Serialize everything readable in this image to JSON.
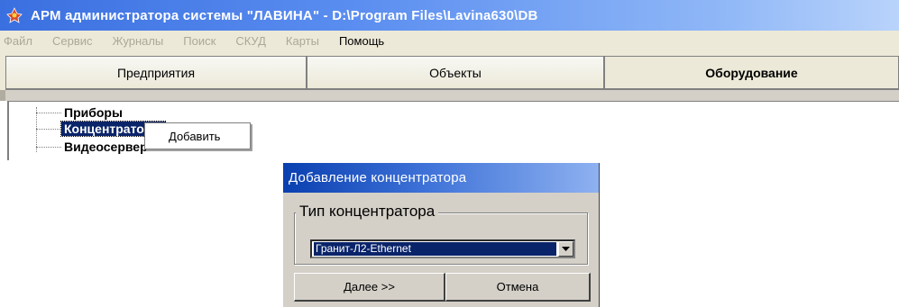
{
  "window": {
    "title": "АРМ администратора системы \"ЛАВИНА\" - D:\\Program Files\\Lavina630\\DB",
    "icon": "app-logo-icon"
  },
  "menu": {
    "items": [
      {
        "label": "Файл",
        "enabled": false
      },
      {
        "label": "Сервис",
        "enabled": false
      },
      {
        "label": "Журналы",
        "enabled": false
      },
      {
        "label": "Поиск",
        "enabled": false
      },
      {
        "label": "СКУД",
        "enabled": false
      },
      {
        "label": "Карты",
        "enabled": false
      },
      {
        "label": "Помощь",
        "enabled": true
      }
    ]
  },
  "tabs": [
    {
      "label": "Предприятия",
      "active": false
    },
    {
      "label": "Объекты",
      "active": false
    },
    {
      "label": "Оборудование",
      "active": true
    }
  ],
  "tree": {
    "nodes": [
      {
        "label": "Приборы",
        "selected": false
      },
      {
        "label": "Концентраторы",
        "selected": true
      },
      {
        "label": "Видеосерверы",
        "selected": false
      }
    ]
  },
  "context_menu": {
    "items": [
      {
        "label": "Добавить"
      }
    ]
  },
  "dialog": {
    "title": "Добавление концентратора",
    "group_label": "Тип концентратора",
    "select_value": "Гранит-Л2-Ethernet",
    "next_label": "Далее >>",
    "cancel_label": "Отмена"
  },
  "colors": {
    "title_bar": "#3a6fe0",
    "selection": "#0a246a",
    "face": "#d4d0c8"
  }
}
